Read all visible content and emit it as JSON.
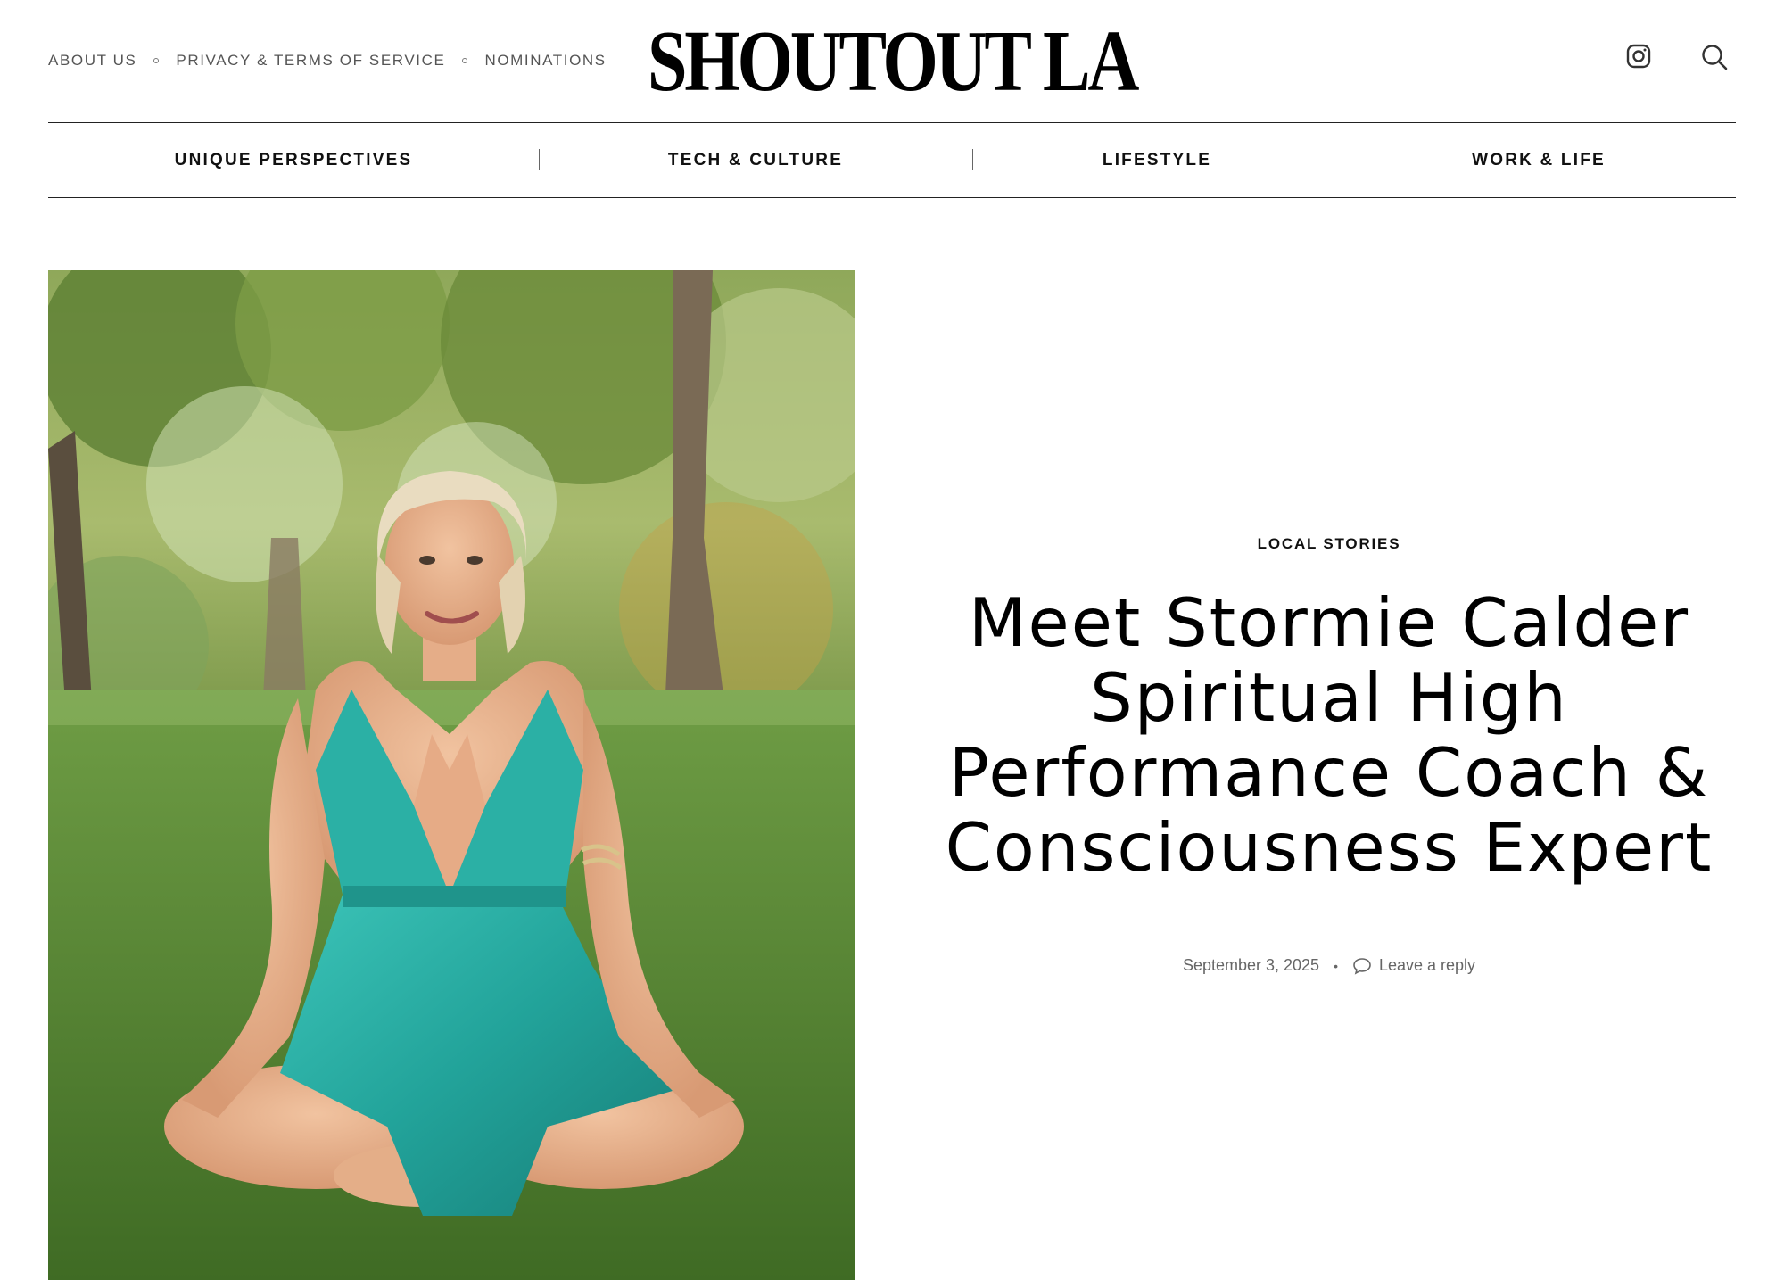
{
  "header": {
    "links": [
      "About Us",
      "Privacy & Terms of Service",
      "Nominations"
    ],
    "logo": "SHOUTOUT LA",
    "icons": [
      "instagram-icon",
      "search-icon"
    ]
  },
  "nav": {
    "items": [
      "UNIQUE PERSPECTIVES",
      "TECH & CULTURE",
      "LIFESTYLE",
      "WORK & LIFE"
    ]
  },
  "article": {
    "category": "LOCAL STORIES",
    "title": "Meet Stormie Calder Spiritual High Performance Coach & Consciousness Expert",
    "date": "September 3, 2025",
    "separator": "•",
    "reply_label": "Leave a reply",
    "image_subject": "woman in teal halter dress sitting cross-legged on grass in a park"
  },
  "colors": {
    "text": "#111111",
    "muted": "#666666",
    "rule": "#222222",
    "grass": "#5f8f3a",
    "dress": "#2fb3a8"
  }
}
